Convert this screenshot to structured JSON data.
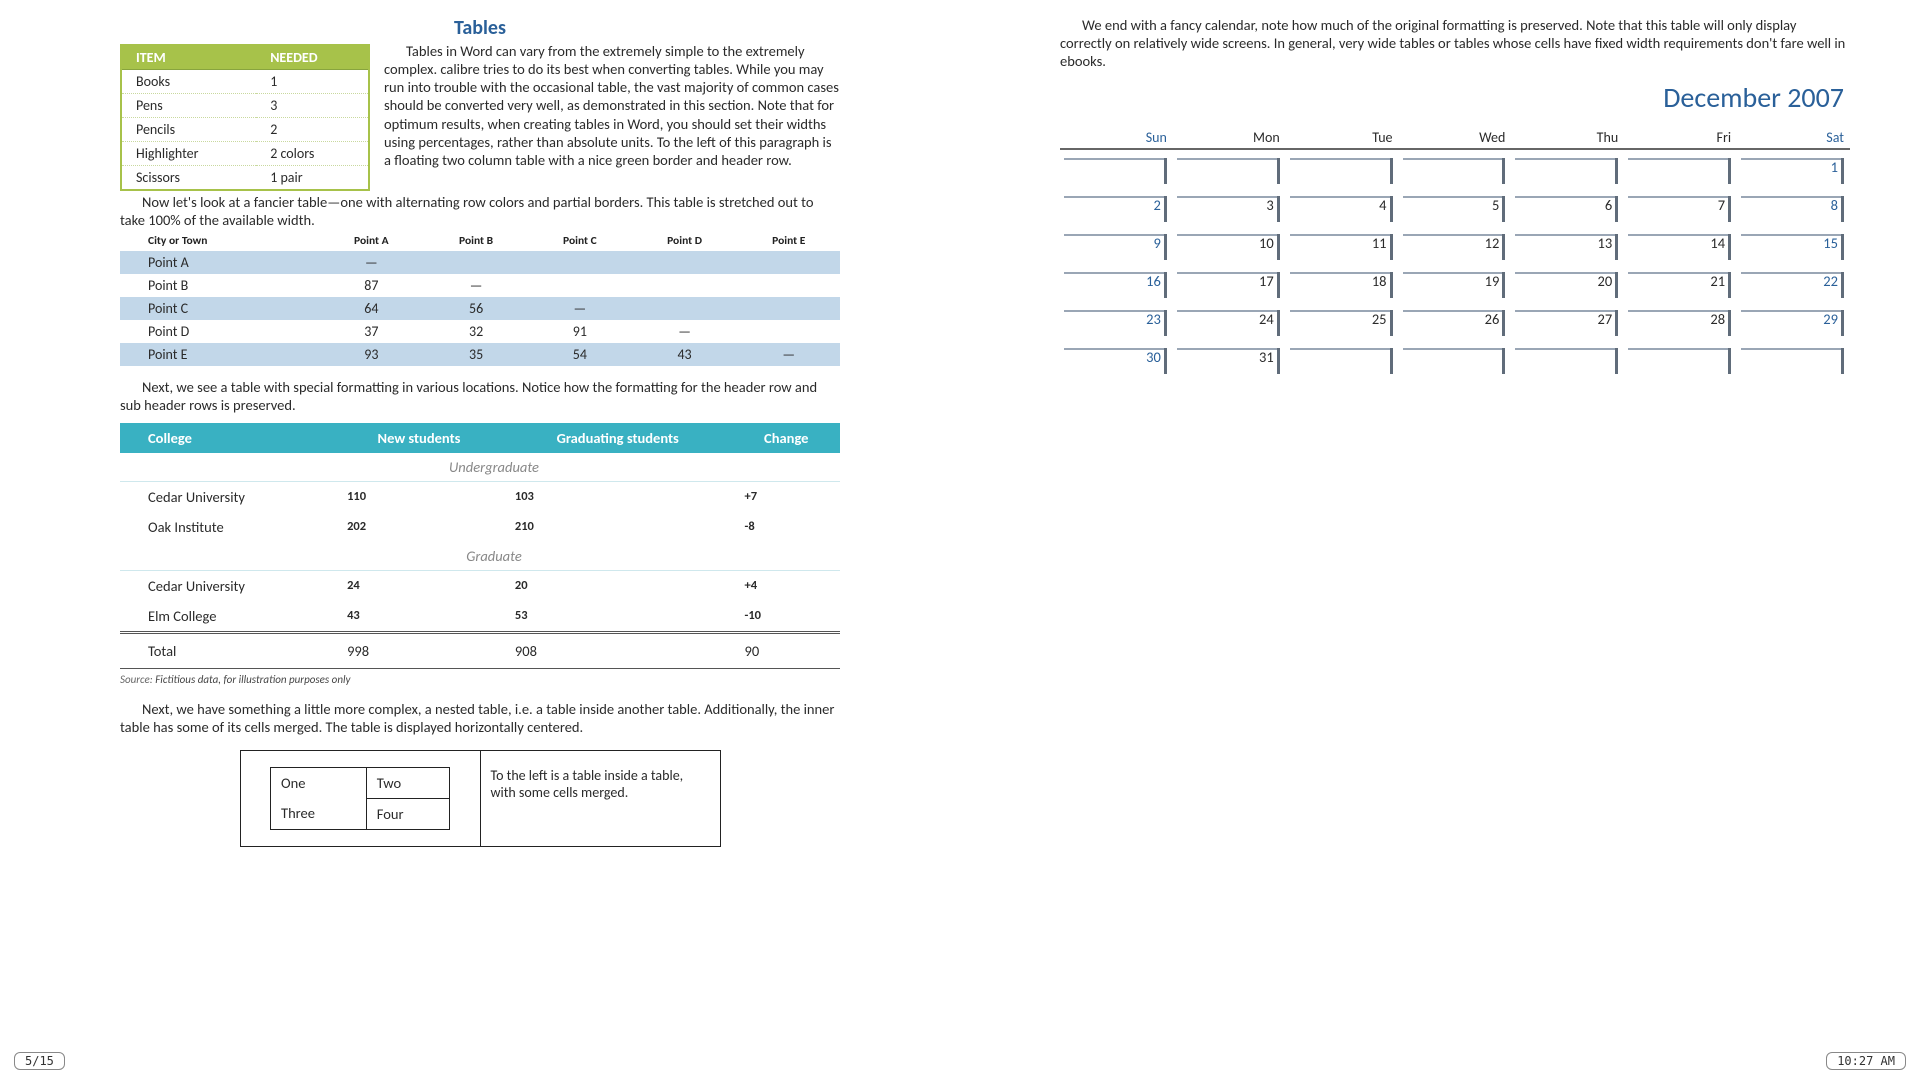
{
  "left": {
    "heading": "Tables",
    "intro": "Tables in Word can vary from the extremely simple to the extremely complex. calibre tries to do its best when converting tables. While you may run into trouble with the occasional table, the vast majority of common cases should be converted very well, as demonstrated in this section. Note that for optimum results, when creating tables in Word, you should set their widths using percentages, rather than absolute units. To the left of this paragraph is a floating two column table with a nice green border and header row.",
    "green_headers": [
      "ITEM",
      "NEEDED"
    ],
    "green_rows": [
      [
        "Books",
        "1"
      ],
      [
        "Pens",
        "3"
      ],
      [
        "Pencils",
        "2"
      ],
      [
        "Highlighter",
        "2 colors"
      ],
      [
        "Scissors",
        "1 pair"
      ]
    ],
    "p2": "Now let's look at a fancier table—one with alternating row colors and partial borders. This table is stretched out to take 100% of the available width.",
    "alt_headers": [
      "City or Town",
      "Point A",
      "Point B",
      "Point C",
      "Point D",
      "Point E"
    ],
    "alt_rows": [
      [
        "Point A",
        "—",
        "",
        "",
        "",
        ""
      ],
      [
        "Point B",
        "87",
        "—",
        "",
        "",
        ""
      ],
      [
        "Point C",
        "64",
        "56",
        "—",
        "",
        ""
      ],
      [
        "Point D",
        "37",
        "32",
        "91",
        "—",
        ""
      ],
      [
        "Point E",
        "93",
        "35",
        "54",
        "43",
        "—"
      ]
    ],
    "p3": "Next, we see a table with special formatting in various locations. Notice how the formatting for the header row and sub header rows is preserved.",
    "college_headers": [
      "College",
      "New students",
      "Graduating students",
      "Change"
    ],
    "college_sub1": "Undergraduate",
    "college_rows1": [
      [
        "Cedar University",
        "110",
        "103",
        "+7"
      ],
      [
        "Oak Institute",
        "202",
        "210",
        "-8"
      ]
    ],
    "college_sub2": "Graduate",
    "college_rows2": [
      [
        "Cedar University",
        "24",
        "20",
        "+4"
      ],
      [
        "Elm College",
        "43",
        "53",
        "-10"
      ]
    ],
    "college_total": [
      "Total",
      "998",
      "908",
      "90"
    ],
    "source_label": "Source:",
    "source_text": " Fictitious data, for illustration purposes only",
    "p4": "Next, we have something a little more complex, a nested table, i.e. a table inside another table. Additionally, the inner table has some of its cells merged. The table is displayed horizontally centered.",
    "nested": {
      "one": "One",
      "two": "Two",
      "three": "Three",
      "four": "Four",
      "caption": "To the left is a table inside a table, with some cells merged."
    }
  },
  "right": {
    "p1": "We end with a fancy calendar, note how much of the original formatting is preserved. Note that this table will only display correctly on relatively wide screens. In general, very wide tables or tables whose cells have fixed width requirements don't fare well in ebooks.",
    "cal_title": "December 2007",
    "weekdays": [
      "Sun",
      "Mon",
      "Tue",
      "Wed",
      "Thu",
      "Fri",
      "Sat"
    ],
    "weeks": [
      [
        "",
        "",
        "",
        "",
        "",
        "",
        "1"
      ],
      [
        "2",
        "3",
        "4",
        "5",
        "6",
        "7",
        "8"
      ],
      [
        "9",
        "10",
        "11",
        "12",
        "13",
        "14",
        "15"
      ],
      [
        "16",
        "17",
        "18",
        "19",
        "20",
        "21",
        "22"
      ],
      [
        "23",
        "24",
        "25",
        "26",
        "27",
        "28",
        "29"
      ],
      [
        "30",
        "31",
        "",
        "",
        "",
        "",
        ""
      ]
    ]
  },
  "footer": {
    "page": "5/15",
    "time": "10:27 AM"
  }
}
